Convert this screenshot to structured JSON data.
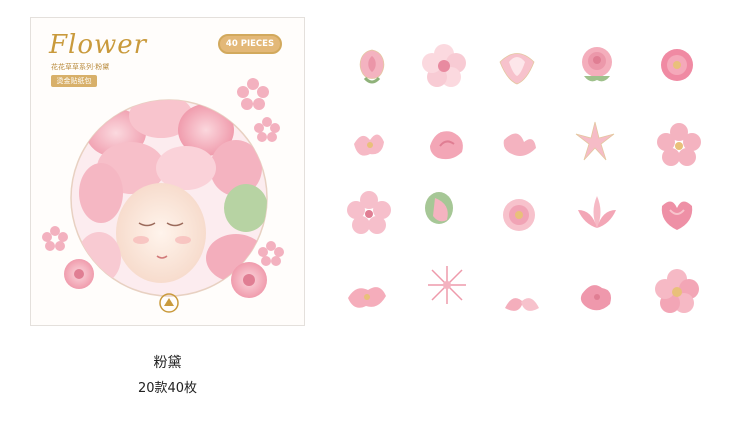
{
  "package": {
    "title": "Flower",
    "subtitle": "花花草草系列·粉黛",
    "tag": "烫金贴纸包",
    "pieces": "40 PIECES",
    "colors": {
      "gold": "#c99a3c",
      "pink": "#f2a9b6",
      "leaf": "#9fc18c"
    }
  },
  "stickers": [
    {
      "name": "rosebud"
    },
    {
      "name": "anemone"
    },
    {
      "name": "magnolia"
    },
    {
      "name": "rose"
    },
    {
      "name": "camellia"
    },
    {
      "name": "petal-cluster"
    },
    {
      "name": "poppy"
    },
    {
      "name": "sweet-pea"
    },
    {
      "name": "lily"
    },
    {
      "name": "sakura"
    },
    {
      "name": "sakura"
    },
    {
      "name": "leaf-bud"
    },
    {
      "name": "peony"
    },
    {
      "name": "lotus"
    },
    {
      "name": "tulip"
    },
    {
      "name": "petals"
    },
    {
      "name": "chrysanthemum"
    },
    {
      "name": "petal-pair"
    },
    {
      "name": "hibiscus"
    },
    {
      "name": "wild-rose"
    }
  ],
  "caption": {
    "name": "粉黛",
    "count": "20款40枚"
  }
}
